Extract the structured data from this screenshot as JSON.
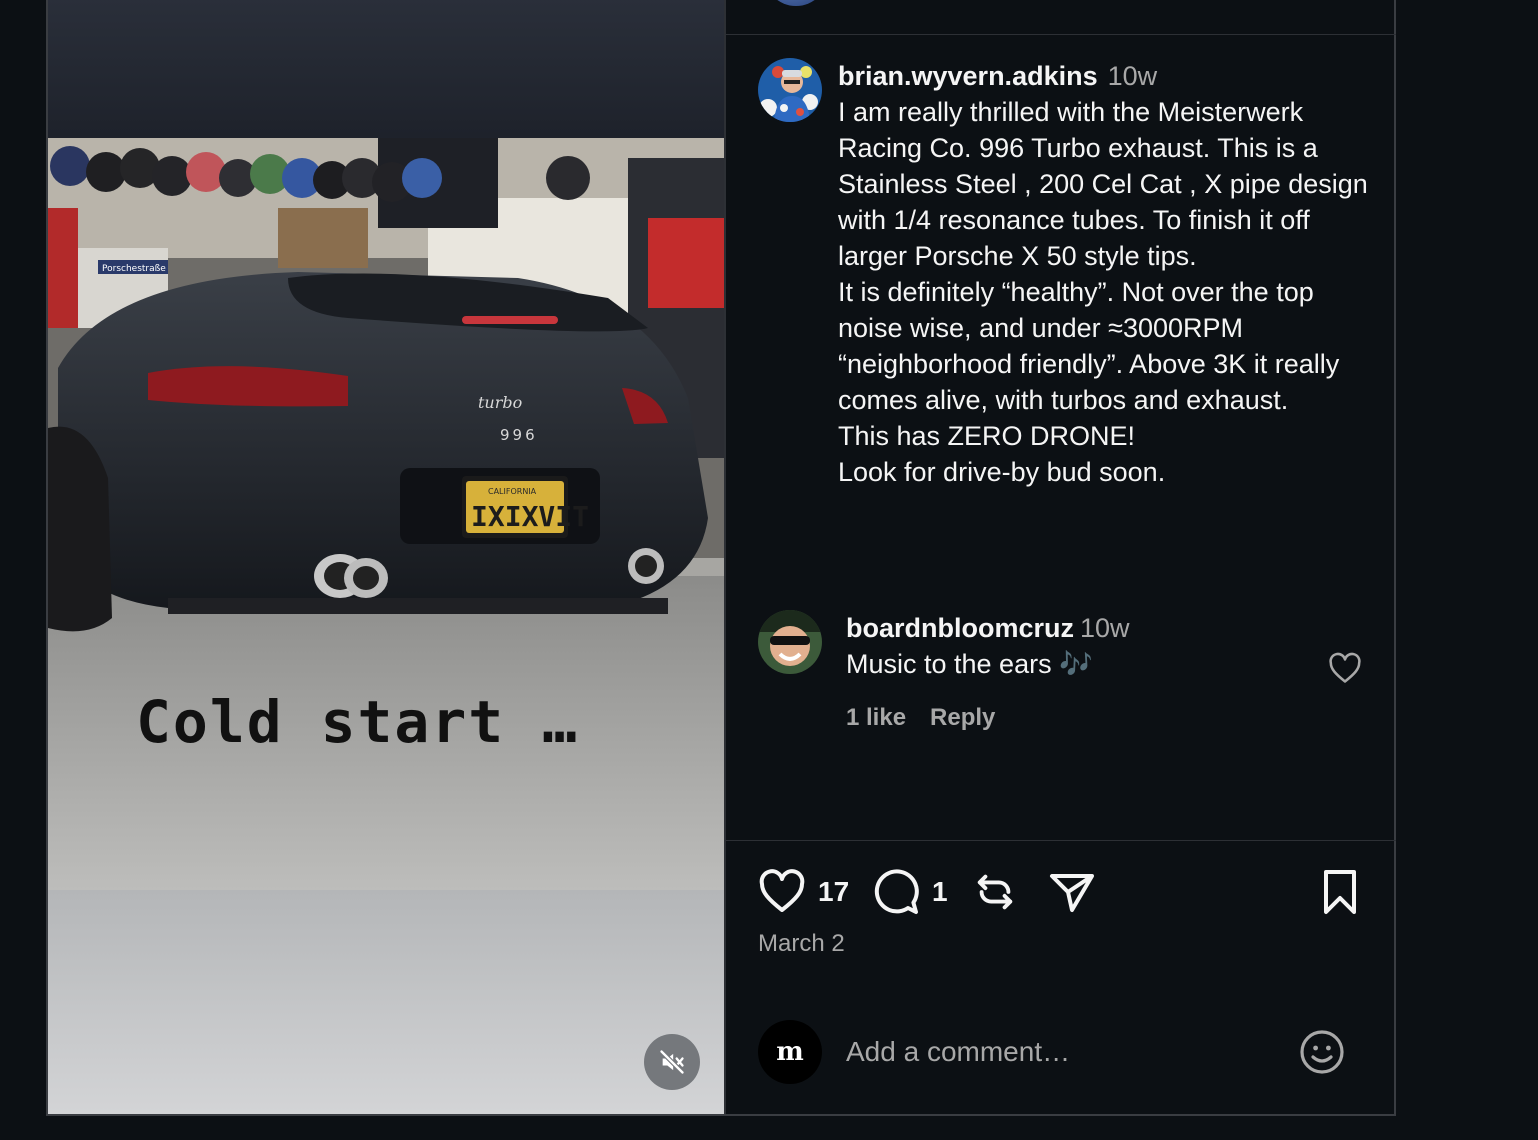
{
  "post": {
    "video_overlay_text": "Cold start …",
    "plate_text": "IXIXVIT",
    "plate_state": "CALIFORNIA",
    "badge_turbo": "turbo",
    "badge_model": "996",
    "street_sign": "Porschestraße",
    "muted": true
  },
  "caption": {
    "username": "brian.wyvern.adkins",
    "time": "10w",
    "text": "I am really thrilled with the Meisterwerk Racing Co. 996 Turbo exhaust. This is a Stainless Steel , 200 Cel Cat , X pipe design with 1/4 resonance tubes. To finish it off larger Porsche X 50 style tips.\nIt is definitely “healthy”. Not over the top noise wise, and under ≈3000RPM “neighborhood friendly”. Above 3K it really comes alive, with turbos and exhaust.\nThis has ZERO DRONE!\nLook for drive-by bud soon."
  },
  "comments": [
    {
      "username": "boardnbloomcruz",
      "time": "10w",
      "text": "Music to the ears 🎶",
      "likes_label": "1 like",
      "reply_label": "Reply"
    }
  ],
  "actions": {
    "likes_count": "17",
    "comments_count": "1",
    "date": "March 2"
  },
  "composer": {
    "avatar_initial": "m",
    "placeholder": "Add a comment…"
  },
  "icons": {
    "like": "heart-icon",
    "comment": "speech-bubble-icon",
    "repost": "repost-icon",
    "share": "paper-plane-icon",
    "save": "bookmark-icon",
    "emoji": "smiley-icon",
    "mute": "speaker-muted-icon"
  },
  "colors": {
    "background": "#0c1014",
    "text_primary": "#f5f5f5",
    "text_secondary": "#a8a8a8",
    "border": "#2d3035"
  }
}
